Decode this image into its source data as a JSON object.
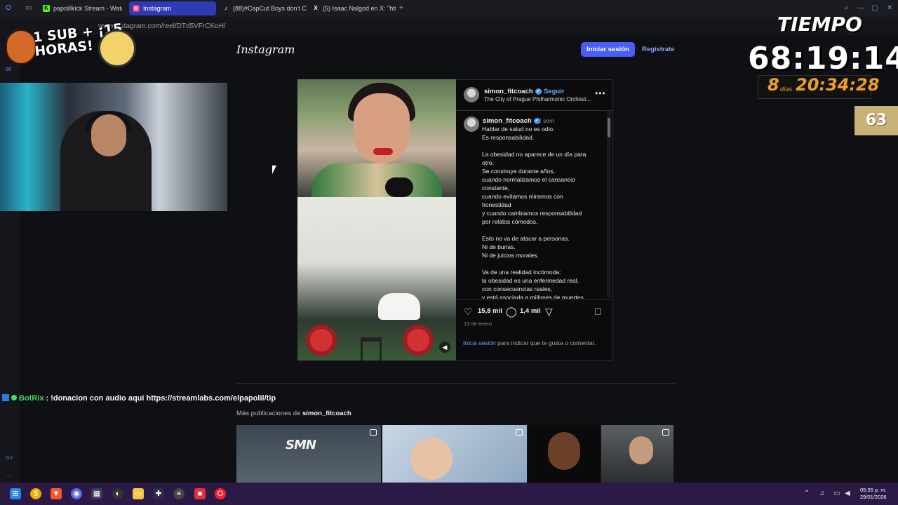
{
  "browser": {
    "tabs": [
      {
        "label": "papolilkick Stream - Watc",
        "icon": "kick-icon",
        "color": "#53fc18"
      },
      {
        "label": "Instagram",
        "icon": "instagram-icon",
        "color": "#e1306c",
        "active": true
      },
      {
        "label": "(88)#CapCut Boys don't C",
        "icon": "tiktok-icon",
        "color": "#ffffff"
      },
      {
        "label": "(5) Isaac Nalgod en X: \"http",
        "icon": "x-icon",
        "color": "#ffffff"
      }
    ],
    "new_tab_label": "+",
    "url": "www.instagram.com/reel/DTd5VFrCKoH/"
  },
  "instagram": {
    "logo": "Instagram",
    "login_label": "Iniciar sesión",
    "signup_label": "Regístrate",
    "post": {
      "username": "simon_fitcoach",
      "follow_label": "• Seguir",
      "audio": "The City of Prague Philharmonic Orchest...",
      "caption_username": "simon_fitcoach",
      "caption_time": "2 sem",
      "caption_lines": [
        "Hablar de salud no es odio.",
        "Es responsabilidad.",
        "",
        "La obesidad no aparece de un día para",
        "otro.",
        "Se construye durante años,",
        "cuando normalizamos el cansancio",
        "constante,",
        "cuando evitamos mirarnos con",
        "honestidad",
        "y cuando cambiamos responsabilidad",
        "por relatos cómodos.",
        "",
        "Esto no va de atacar a personas.",
        "Ni de burlas.",
        "Ni de juicios morales.",
        "",
        "Va de una realidad incómoda:",
        "la obesidad es una enfermedad real,",
        "con consecuencias reales,",
        "y está asociada a millones de muertes"
      ],
      "likes": "15,8 mil",
      "comments": "1,4 mil",
      "date": "13 de enero",
      "login_prompt_link": "Inicia sesión",
      "login_prompt_rest": " para indicar que te gusta o comentar."
    },
    "more_posts_prefix": "Más publicaciones de ",
    "more_posts_user": "simon_fitcoach",
    "thumb1_logo": "SMN"
  },
  "overlay": {
    "sub_text": "1 SUB + ¡15 HORAS!",
    "timer_title": "TIEMPO",
    "timer_main": "68:19:14",
    "timer_days": "8",
    "timer_days_label": "días",
    "timer_clock": "20:34:28",
    "counter": "63",
    "chat_user": "BotRix",
    "chat_message": " : !donacion con audio aqui https://streamlabs.com/elpapolil/tip"
  },
  "taskbar": {
    "time": "05:35 p. m.",
    "date": "29/01/2026"
  },
  "colors": {
    "accent": "#4a5df9",
    "link": "#6da8ff",
    "taskbar": "#2a1a45"
  }
}
